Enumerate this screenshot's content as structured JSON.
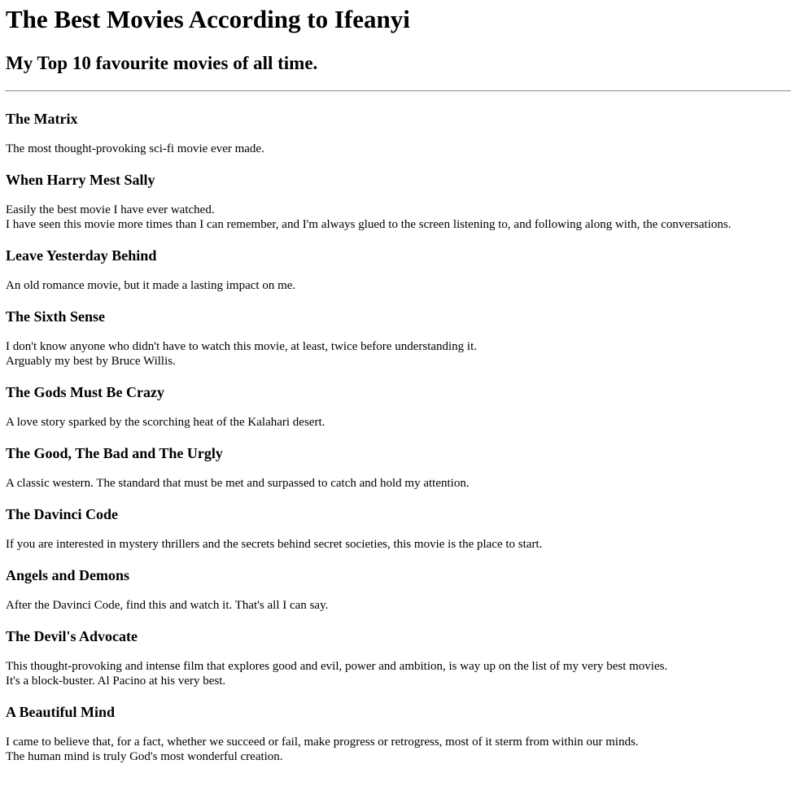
{
  "header": {
    "title": "The Best Movies According to Ifeanyi",
    "subtitle": "My Top 10 favourite movies of all time."
  },
  "movies": [
    {
      "title": "The Matrix",
      "lines": [
        "The most thought-provoking sci-fi movie ever made."
      ]
    },
    {
      "title": "When Harry Mest Sally",
      "lines": [
        "Easily the best movie I have ever watched.",
        "I have seen this movie more times than I can remember, and I'm always glued to the screen listening to, and following along with, the conversations."
      ]
    },
    {
      "title": "Leave Yesterday Behind",
      "lines": [
        "An old romance movie, but it made a lasting impact on me."
      ]
    },
    {
      "title": "The Sixth Sense",
      "lines": [
        "I don't know anyone who didn't have to watch this movie, at least, twice before understanding it.",
        "Arguably my best by Bruce Willis."
      ]
    },
    {
      "title": "The Gods Must Be Crazy",
      "lines": [
        "A love story sparked by the scorching heat of the Kalahari desert."
      ]
    },
    {
      "title": "The Good, The Bad and The Urgly",
      "lines": [
        "A classic western. The standard that must be met and surpassed to catch and hold my attention."
      ]
    },
    {
      "title": "The Davinci Code",
      "lines": [
        "If you are interested in mystery thrillers and the secrets behind secret societies, this movie is the place to start."
      ]
    },
    {
      "title": "Angels and Demons",
      "lines": [
        "After the Davinci Code, find this and watch it. That's all I can say."
      ]
    },
    {
      "title": "The Devil's Advocate",
      "lines": [
        "This thought-provoking and intense film that explores good and evil, power and ambition, is way up on the list of my very best movies.",
        "It's a block-buster. Al Pacino at his very best."
      ]
    },
    {
      "title": "A Beautiful Mind",
      "lines": [
        "I came to believe that, for a fact, whether we succeed or fail, make progress or retrogress, most of it sterm from within our minds.",
        "The human mind is truly God's most wonderful creation."
      ]
    }
  ]
}
